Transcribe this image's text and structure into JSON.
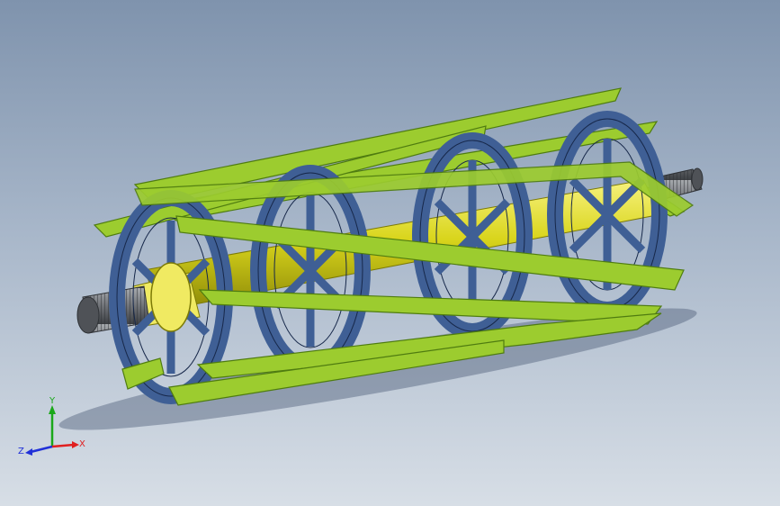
{
  "viewport": {
    "background_top": "#7f93ad",
    "background_bottom": "#d7dee6"
  },
  "model": {
    "blade_color": "#9ccc2f",
    "blade_edge_color": "#4f7c10",
    "spider_color": "#3f5f95",
    "spider_edge_color": "#17284a",
    "shaft_color": "#d9d51c",
    "shaft_edge_color": "#7c7a06",
    "hub_color": "#f0ea62",
    "thread_color": "#6f7277",
    "thread_cap_color": "#4f5257"
  },
  "triad": {
    "x_label": "X",
    "y_label": "Y",
    "z_label": "Z",
    "x_color": "#e02020",
    "y_color": "#1aa81a",
    "z_color": "#2030d8"
  }
}
